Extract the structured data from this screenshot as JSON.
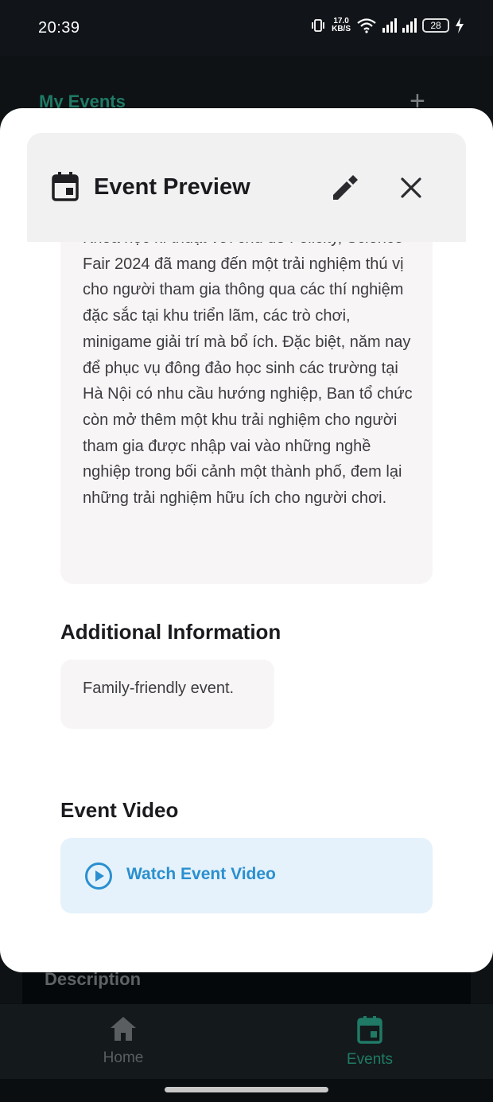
{
  "status_bar": {
    "time": "20:39",
    "speed_value": "17.0",
    "speed_unit": "KB/S",
    "battery": "28"
  },
  "background": {
    "title": "My Events",
    "add_icon": "plus-icon",
    "description_heading": "Description"
  },
  "modal": {
    "title": "Event Preview",
    "description": "Khoa học kĩ thuật với chủ đề Felicity, Science Fair 2024 đã mang đến một trải nghiệm thú vị cho người tham gia thông qua các thí nghiệm đặc sắc tại khu triển lãm, các trò chơi, minigame giải trí mà bổ ích.  Đặc biệt, năm nay để phục vụ đông đảo học sinh các trường tại Hà Nội có nhu cầu hướng nghiệp, Ban tổ chức còn mở thêm một khu trải nghiệm cho người tham gia được nhập vai vào những nghề nghiệp trong bối cảnh một thành phố, đem lại những trải nghiệm hữu ích cho người chơi.",
    "additional_info_title": "Additional Information",
    "additional_info_text": "Family-friendly event.",
    "video_title": "Event Video",
    "video_button": "Watch Event Video"
  },
  "bottom_nav": {
    "home_label": "Home",
    "events_label": "Events"
  },
  "colors": {
    "accent_green": "#1f7a66",
    "link_blue": "#2a8fd0",
    "video_bg": "#e5f2fb",
    "card_bg": "#f8f5f7"
  }
}
